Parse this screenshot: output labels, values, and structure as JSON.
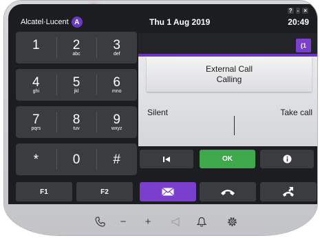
{
  "brand": {
    "name": "Alcatel·Lucent",
    "logo_glyph": "A"
  },
  "header": {
    "date": "Thu 1 Aug 2019",
    "time": "20:49"
  },
  "window_controls": [
    "?",
    "-",
    "×"
  ],
  "keypad": {
    "keys": [
      {
        "digit": "1",
        "letters": ""
      },
      {
        "digit": "2",
        "letters": "abc"
      },
      {
        "digit": "3",
        "letters": "def"
      },
      {
        "digit": "4",
        "letters": "ghi"
      },
      {
        "digit": "5",
        "letters": "jkl"
      },
      {
        "digit": "6",
        "letters": "mno"
      },
      {
        "digit": "7",
        "letters": "pqrs"
      },
      {
        "digit": "8",
        "letters": "tuv"
      },
      {
        "digit": "9",
        "letters": "wxyz"
      },
      {
        "digit": "*",
        "letters": ""
      },
      {
        "digit": "0",
        "letters": ""
      },
      {
        "digit": "#",
        "letters": ""
      }
    ],
    "f1": "F1",
    "f2": "F2"
  },
  "call": {
    "badge": "(1",
    "title": "External Call",
    "status": "Calling",
    "option_silent": "Silent",
    "option_take": "Take call"
  },
  "actions": {
    "back_icon": "skip-back-icon",
    "ok_label": "OK",
    "info_icon": "info-icon",
    "mail_icon": "mail-icon",
    "hangup_icon": "hangup-icon",
    "transfer_icon": "transfer-icon"
  },
  "bottombar": {
    "items": [
      "handset-icon",
      "minus-icon",
      "plus-icon",
      "speaker-icon",
      "bell-icon",
      "settings-icon"
    ],
    "minus_glyph": "−",
    "plus_glyph": "+"
  },
  "colors": {
    "accent_purple": "#7b3fd0",
    "ok_green": "#3ca94b",
    "key_dark": "#3b3c40",
    "led_red": "#e02323"
  }
}
